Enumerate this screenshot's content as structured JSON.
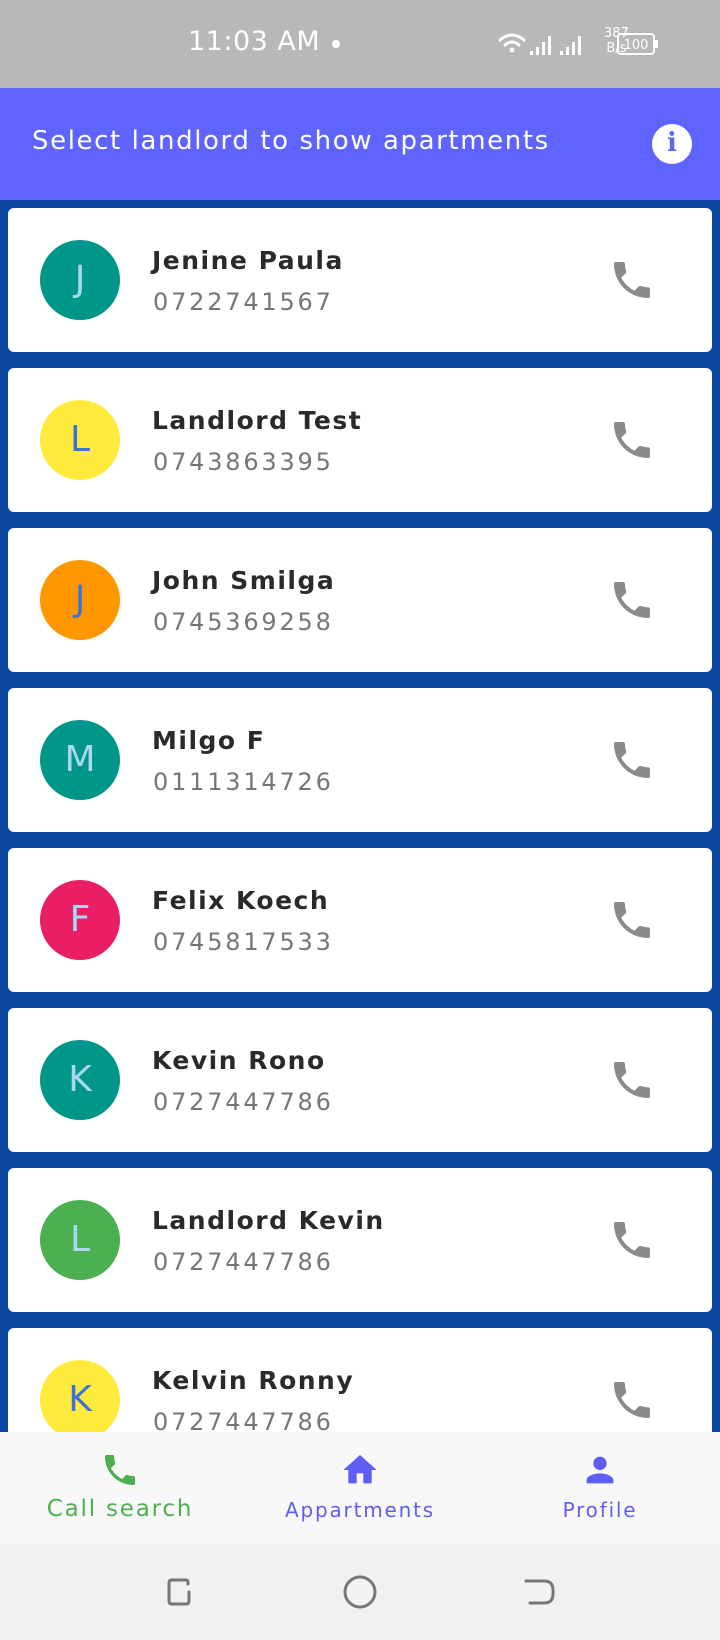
{
  "status_bar": {
    "time": "11:03 AM",
    "net_speed_value": "387",
    "net_speed_unit": "B/s",
    "battery": "100"
  },
  "app_bar": {
    "title": "Select landlord to show apartments",
    "info_icon": "info-icon"
  },
  "landlords": [
    {
      "initial": "J",
      "name": "Jenine Paula",
      "phone": "0722741567",
      "avatar_bg": "#009688",
      "initial_color": "#a7d9f5"
    },
    {
      "initial": "L",
      "name": "Landlord Test",
      "phone": "0743863395",
      "avatar_bg": "#ffeb3b",
      "initial_color": "#3f72d9"
    },
    {
      "initial": "J",
      "name": "John Smilga",
      "phone": "0745369258",
      "avatar_bg": "#ff9800",
      "initial_color": "#3f72d9"
    },
    {
      "initial": "M",
      "name": "Milgo F",
      "phone": "0111314726",
      "avatar_bg": "#009688",
      "initial_color": "#a7d9f5"
    },
    {
      "initial": "F",
      "name": "Felix Koech",
      "phone": "0745817533",
      "avatar_bg": "#e91e63",
      "initial_color": "#a7d9f5"
    },
    {
      "initial": "K",
      "name": "Kevin Rono",
      "phone": "0727447786",
      "avatar_bg": "#009688",
      "initial_color": "#a7d9f5"
    },
    {
      "initial": "L",
      "name": "Landlord Kevin",
      "phone": "0727447786",
      "avatar_bg": "#4caf50",
      "initial_color": "#a7d9f5"
    },
    {
      "initial": "K",
      "name": "Kelvin Ronny",
      "phone": "0727447786",
      "avatar_bg": "#ffeb3b",
      "initial_color": "#3f72d9"
    }
  ],
  "bottom_nav": {
    "items": [
      {
        "label": "Call search",
        "icon": "phone-icon",
        "active": true
      },
      {
        "label": "Appartments",
        "icon": "home-icon",
        "active": false
      },
      {
        "label": "Profile",
        "icon": "person-icon",
        "active": false
      }
    ]
  },
  "colors": {
    "app_bar": "#6064fe",
    "list_background": "#0d47a1",
    "active_nav": "#4caf50",
    "inactive_nav": "#5e5ef6",
    "call_icon": "#8a8a8a"
  }
}
